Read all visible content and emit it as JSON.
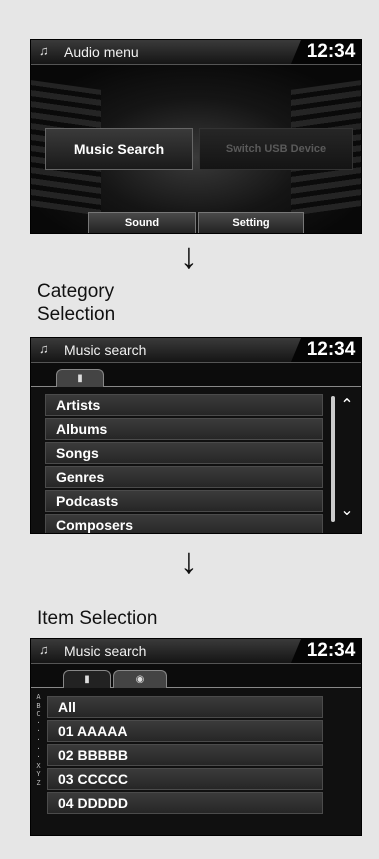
{
  "audio_menu": {
    "title": "Audio menu",
    "clock": "12:34",
    "music_search_label": "Music Search",
    "switch_usb_label": "Switch USB Device",
    "sound_label": "Sound",
    "setting_label": "Setting",
    "title_icon": "music-note-icon"
  },
  "captions": {
    "category_line1": "Category",
    "category_line2": "Selection",
    "item": "Item Selection",
    "arrow": "↓"
  },
  "category_search": {
    "title": "Music search",
    "clock": "12:34",
    "tab_icon": "ipod-icon",
    "items": [
      "Artists",
      "Albums",
      "Songs",
      "Genres",
      "Podcasts",
      "Composers"
    ]
  },
  "item_search": {
    "title": "Music search",
    "clock": "12:34",
    "tabs": [
      "ipod-icon",
      "disc-icon"
    ],
    "items": [
      "All",
      "01  AAAAA",
      "02  BBBBB",
      "03  CCCCC",
      "04  DDDDD"
    ],
    "alpha_index": [
      "A",
      "B",
      "C",
      "·",
      "·",
      "·",
      "·",
      "·",
      "X",
      "Y",
      "Z"
    ]
  },
  "colors": {
    "screen_bg": "#101010",
    "page_bg": "#e6e6e6",
    "text": "#ffffff",
    "disabled": "#5a5a5a"
  }
}
